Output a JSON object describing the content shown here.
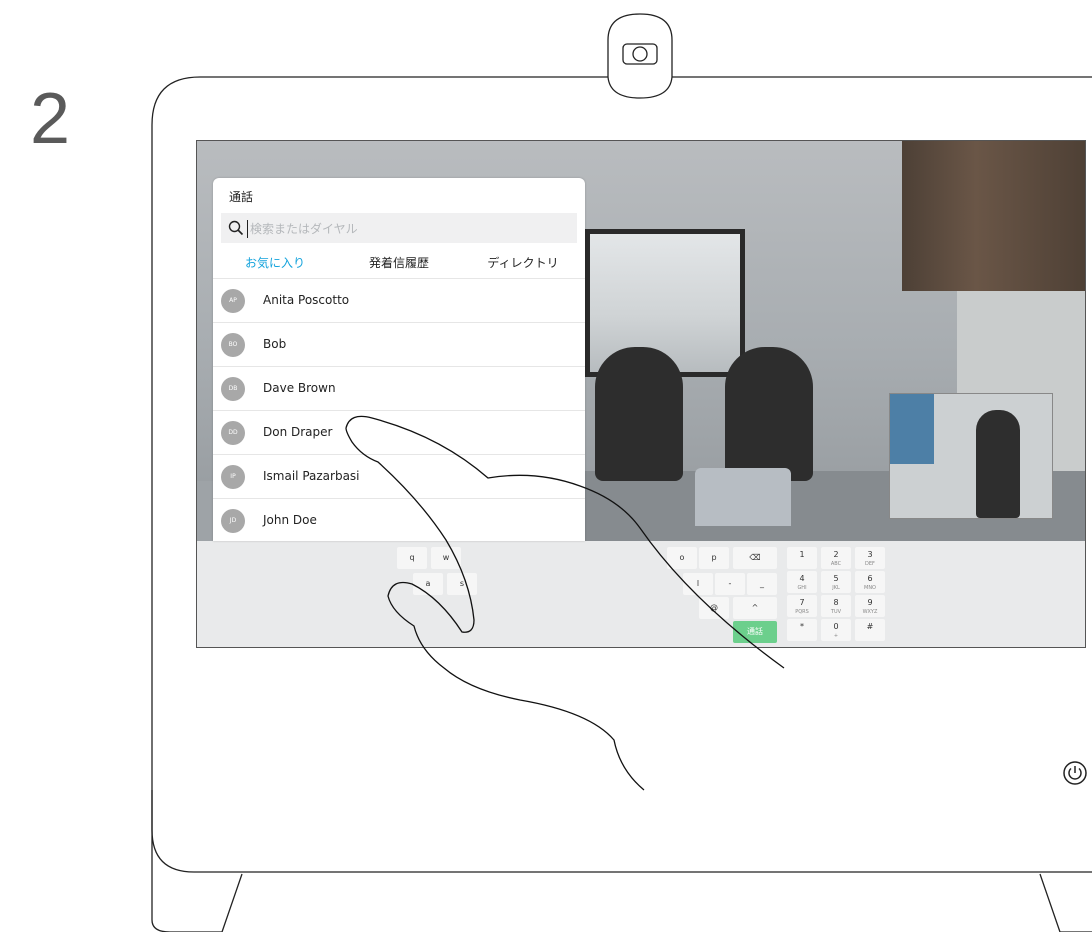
{
  "step_number": "2",
  "panel": {
    "title": "通話",
    "search_placeholder": "検索またはダイヤル",
    "tabs": [
      {
        "label": "お気に入り",
        "active": true
      },
      {
        "label": "発着信履歴",
        "active": false
      },
      {
        "label": "ディレクトリ",
        "active": false
      }
    ],
    "contacts": [
      {
        "initials": "AP",
        "name": "Anita Poscotto"
      },
      {
        "initials": "BO",
        "name": "Bob"
      },
      {
        "initials": "DB",
        "name": "Dave Brown"
      },
      {
        "initials": "DD",
        "name": "Don Draper"
      },
      {
        "initials": "IP",
        "name": "Ismail Pazarbasi"
      },
      {
        "initials": "JD",
        "name": "John Doe"
      }
    ]
  },
  "keyboard": {
    "letters_row1": [
      "q",
      "w",
      "o",
      "p"
    ],
    "letters_row2": [
      "a",
      "s",
      "l",
      "-",
      "_"
    ],
    "symbols": [
      "@",
      "^"
    ],
    "backspace_icon": "backspace-icon",
    "call_label": "通話",
    "numpad": [
      {
        "digit": "1",
        "letters": ""
      },
      {
        "digit": "2",
        "letters": "ABC"
      },
      {
        "digit": "3",
        "letters": "DEF"
      },
      {
        "digit": "4",
        "letters": "GHI"
      },
      {
        "digit": "5",
        "letters": "JKL"
      },
      {
        "digit": "6",
        "letters": "MNO"
      },
      {
        "digit": "7",
        "letters": "PQRS"
      },
      {
        "digit": "8",
        "letters": "TUV"
      },
      {
        "digit": "9",
        "letters": "WXYZ"
      },
      {
        "digit": "*",
        "letters": ""
      },
      {
        "digit": "0",
        "letters": "+"
      },
      {
        "digit": "#",
        "letters": ""
      }
    ]
  },
  "colors": {
    "accent": "#14a3dc",
    "call_green": "#6ccf8c",
    "avatar_gray": "#a8a8a8"
  },
  "icons": [
    "camera-icon",
    "search-icon",
    "backspace-icon",
    "power-icon",
    "hand-pointer-icon"
  ]
}
